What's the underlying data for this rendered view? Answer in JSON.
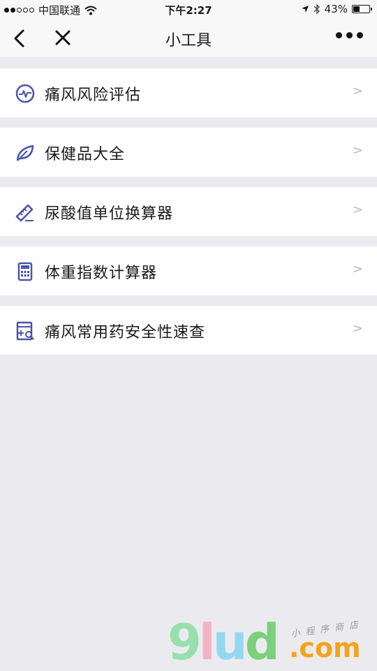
{
  "status_bar": {
    "carrier": "中国联通",
    "time": "下午2:27",
    "battery": "43%",
    "battery_level": 0.43
  },
  "navbar": {
    "title": "小工具"
  },
  "list": {
    "items": [
      {
        "label": "痛风风险评估",
        "arrow": ">",
        "icon": "heart-pulse-circle-icon"
      },
      {
        "label": "保健品大全",
        "arrow": ">",
        "icon": "leaf-icon"
      },
      {
        "label": "尿酸值单位换算器",
        "arrow": ">",
        "icon": "ruler-icon"
      },
      {
        "label": "体重指数计算器",
        "arrow": ">",
        "icon": "calculator-icon"
      },
      {
        "label": "痛风常用药安全性速查",
        "arrow": ">",
        "icon": "drug-search-icon"
      }
    ]
  },
  "watermark": {
    "brand_g": "9",
    "brand_l": "l",
    "brand_u": "u",
    "brand_d": "d",
    "brand_suffix": ".com",
    "tagline": "小程序商店"
  },
  "colors": {
    "icon_accent": "#4a54a8",
    "background": "#ebebef",
    "arrow": "#b9b9b9"
  }
}
